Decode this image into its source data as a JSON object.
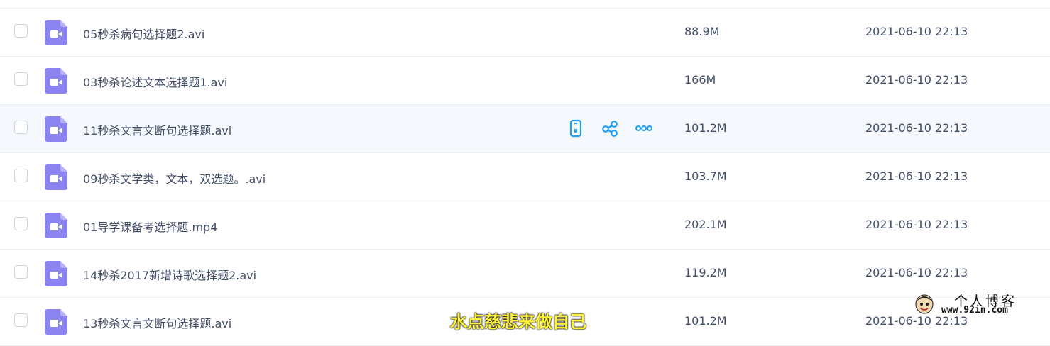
{
  "files": [
    {
      "name": "05秒杀病句选择题2.avi",
      "size": "88.9M",
      "modified": "2021-06-10 22:13",
      "icon": "video-file-icon"
    },
    {
      "name": "03秒杀论述文本选择题1.avi",
      "size": "166M",
      "modified": "2021-06-10 22:13",
      "icon": "video-file-icon"
    },
    {
      "name": "11秒杀文言文断句选择题.avi",
      "size": "101.2M",
      "modified": "2021-06-10 22:13",
      "icon": "video-file-icon",
      "hovered": true
    },
    {
      "name": "09秒杀文学类，文本，双选题。.avi",
      "size": "103.7M",
      "modified": "2021-06-10 22:13",
      "icon": "video-file-icon"
    },
    {
      "name": "01导学课备考选择题.mp4",
      "size": "202.1M",
      "modified": "2021-06-10 22:13",
      "icon": "video-file-icon"
    },
    {
      "name": "14秒杀2017新增诗歌选择题2.avi",
      "size": "119.2M",
      "modified": "2021-06-10 22:13",
      "icon": "video-file-icon"
    },
    {
      "name": "13秒杀文言文断句选择题.avi",
      "size": "101.2M",
      "modified": "2021-06-10 22:13",
      "icon": "video-file-icon"
    }
  ],
  "row_actions": [
    "phone-icon",
    "share-icon",
    "more-icon"
  ],
  "overlay_caption": "水点慈悲来做自己",
  "watermark": {
    "title": "个人博客",
    "url": "www.92in.com"
  },
  "colors": {
    "accent": "#1f9ff5",
    "file_icon": "#8a83f0",
    "hover_row": "#f5f9fd",
    "text": "#424e67",
    "divider": "#eef0f4"
  }
}
